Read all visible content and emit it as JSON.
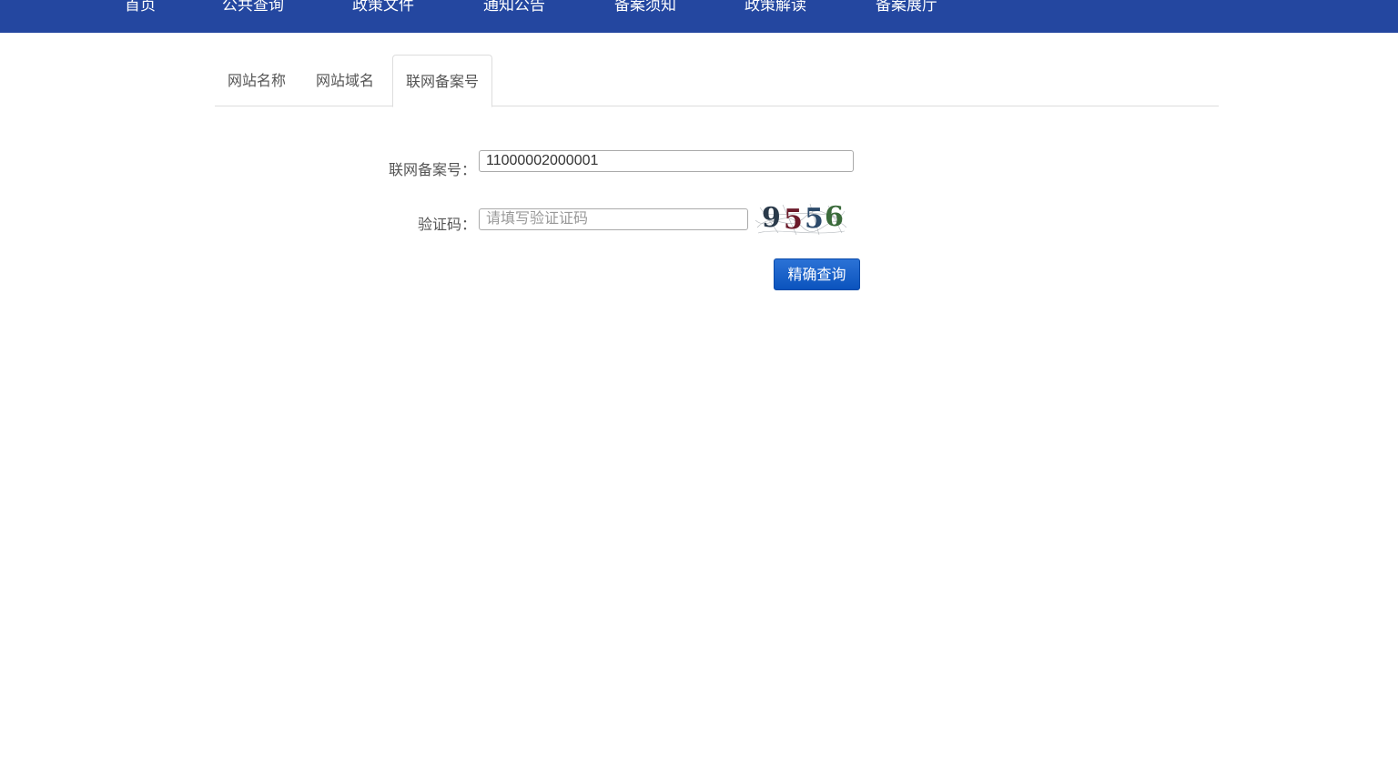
{
  "nav": {
    "items": [
      {
        "label": "首页"
      },
      {
        "label": "公共查询"
      },
      {
        "label": "政策文件"
      },
      {
        "label": "通知公告"
      },
      {
        "label": "备案须知"
      },
      {
        "label": "政策解读"
      },
      {
        "label": "备案展厅"
      }
    ],
    "background": "#2447a0"
  },
  "tabs": {
    "items": [
      {
        "label": "网站名称",
        "active": false
      },
      {
        "label": "网站域名",
        "active": false
      },
      {
        "label": "联网备案号",
        "active": true
      }
    ]
  },
  "form": {
    "record_label": "联网备案号：",
    "record_value": "11000002000001",
    "captcha_label": "验证码：",
    "captcha_placeholder": "请填写验证证码",
    "captcha_text": "9556",
    "submit_label": "精确查询",
    "button_color": "#0b53bd"
  }
}
